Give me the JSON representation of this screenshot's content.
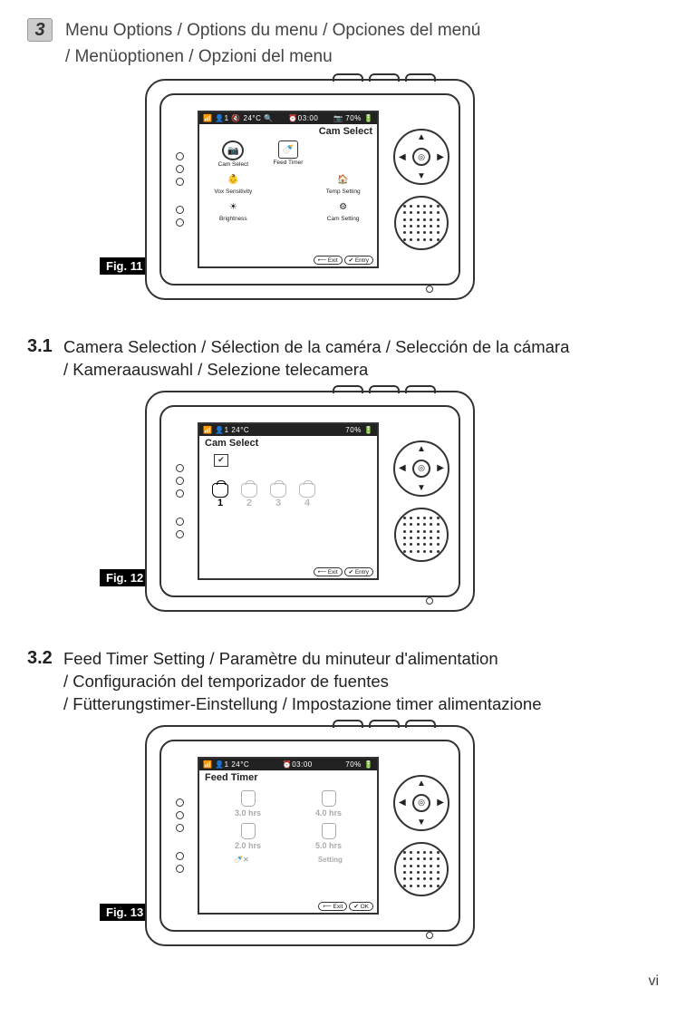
{
  "section": {
    "number": "3",
    "title_line1": "Menu Options / Options du menu / Opciones del menú",
    "title_line2": "/ Menüoptionen / Opzioni del menu"
  },
  "fig11": {
    "label": "Fig. 11",
    "status_left": "📶 👤1 🔇 24°C  🔍",
    "status_mid": "⏰03:00",
    "status_right": "📷 70% 🔋",
    "screen_title": "Cam Select",
    "menu": {
      "cam_select": "Cam Select",
      "feed_timer": "Feed Timer",
      "vox": "Vox Sensitivity",
      "temp": "Temp Setting",
      "brightness": "Brightness",
      "cam_setting": "Cam Setting"
    },
    "exit": "⟵ Exit",
    "entry": "✔ Entry"
  },
  "sub31": {
    "num": "3.1",
    "line1": "Camera Selection / Sélection de la caméra / Selección de la cámara",
    "line2": "/ Kameraauswahl / Selezione telecamera"
  },
  "fig12": {
    "label": "Fig. 12",
    "status_left": "📶 👤1   24°C",
    "status_right": "70% 🔋",
    "screen_title": "Cam Select",
    "cams": [
      "1",
      "2",
      "3",
      "4"
    ],
    "exit": "⟵ Exit",
    "entry": "✔ Entry"
  },
  "sub32": {
    "num": "3.2",
    "line1": "Feed Timer Setting / Paramètre du minuteur d'alimentation",
    "line2": "/ Configuración del temporizador de fuentes",
    "line3": "/ Fütterungstimer-Einstellung / Impostazione timer alimentazione"
  },
  "fig13": {
    "label": "Fig. 13",
    "status_left": "📶 👤1   24°C",
    "status_mid": "⏰03:00",
    "status_right": "70% 🔋",
    "screen_title": "Feed Timer",
    "opts": {
      "a": "3.0 hrs",
      "b": "4.0 hrs",
      "c": "2.0 hrs",
      "d": "5.0 hrs"
    },
    "setting": "Setting",
    "exit": "⟵ Exit",
    "ok": "✔ OK"
  },
  "page": "vi"
}
